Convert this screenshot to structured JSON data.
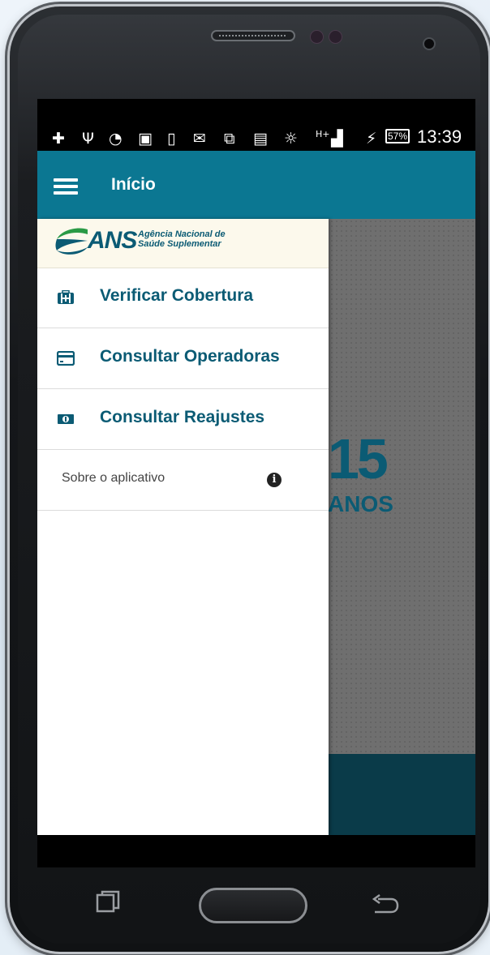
{
  "status_bar": {
    "time": "13:39",
    "battery_percent": "57%",
    "network_label": "H+",
    "icons": [
      "add-icon",
      "usb-icon",
      "messenger-icon",
      "image-icon",
      "screen-icon",
      "gmail-icon",
      "cast-icon",
      "chat-icon",
      "light-bulb-icon",
      "network-icon",
      "signal-icon",
      "charging-icon",
      "battery-icon"
    ]
  },
  "app_bar": {
    "title": "Início",
    "menu_icon": "hamburger-icon"
  },
  "drawer": {
    "logo": {
      "brand": "ANS",
      "line1": "Agência Nacional de",
      "line2": "Saúde Suplementar"
    },
    "items": [
      {
        "label": "Verificar Cobertura",
        "icon": "medical-kit-icon"
      },
      {
        "label": "Consultar Operadoras",
        "icon": "credit-card-icon"
      },
      {
        "label": "Consultar Reajustes",
        "icon": "money-icon"
      }
    ],
    "about": {
      "label": "Sobre o aplicativo",
      "icon": "info-icon"
    }
  },
  "background_logo": {
    "number": "15",
    "word": "ANOS"
  },
  "colors": {
    "app_bar": "#0b7792",
    "brand_text": "#0b5b74",
    "drawer_header": "#fcf9ec",
    "content_overlay": "#6f6f6f",
    "content_footer": "#0a3b49"
  }
}
